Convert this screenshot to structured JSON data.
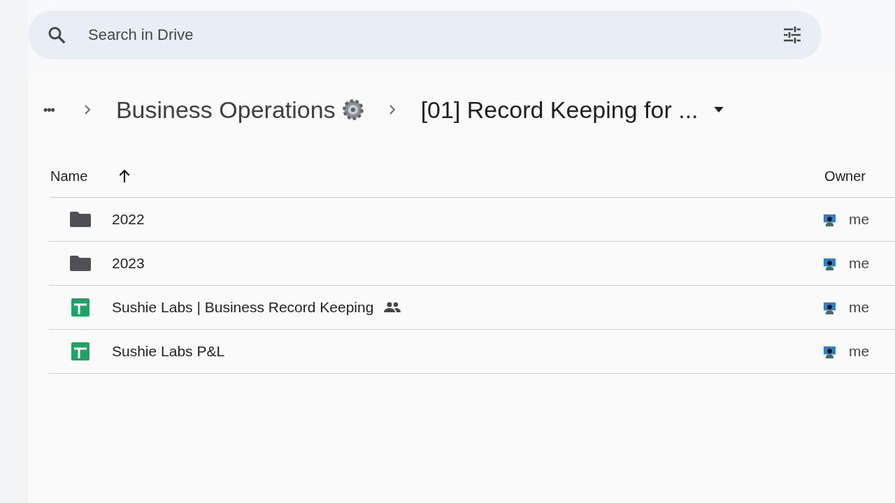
{
  "search": {
    "placeholder": "Search in Drive"
  },
  "breadcrumb": {
    "more": "•••",
    "items": [
      {
        "label": "Business Operations",
        "icon": true
      },
      {
        "label": "[01] Record Keeping for ...",
        "icon": false
      }
    ]
  },
  "table": {
    "columns": [
      {
        "label": "Name",
        "sort_ascending": true
      },
      {
        "label": "Owner"
      }
    ],
    "rows": [
      {
        "kind": "folder",
        "name": "2022",
        "shared": false,
        "owner": "me"
      },
      {
        "kind": "folder",
        "name": "2023",
        "shared": false,
        "owner": "me"
      },
      {
        "kind": "sheet",
        "name": "Sushie Labs | Business Record Keeping",
        "shared": true,
        "owner": "me"
      },
      {
        "kind": "sheet",
        "name": "Sushie Labs P&L",
        "shared": false,
        "owner": "me"
      }
    ]
  }
}
